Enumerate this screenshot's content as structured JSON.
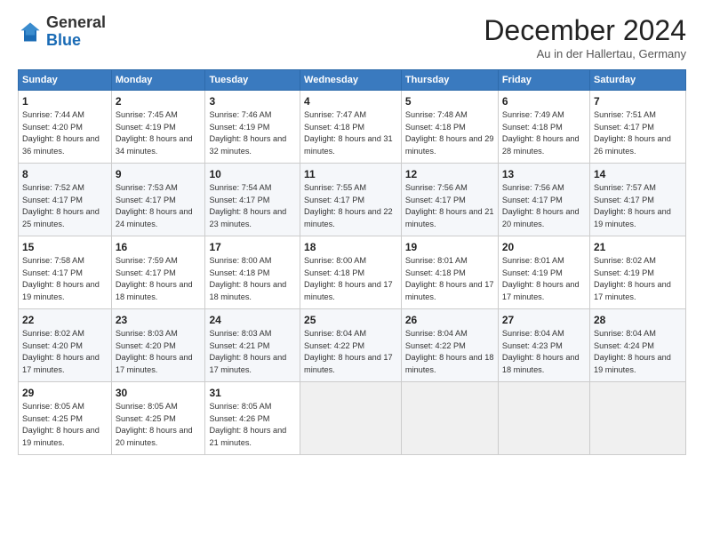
{
  "logo": {
    "general": "General",
    "blue": "Blue"
  },
  "header": {
    "title": "December 2024",
    "location": "Au in der Hallertau, Germany"
  },
  "columns": [
    "Sunday",
    "Monday",
    "Tuesday",
    "Wednesday",
    "Thursday",
    "Friday",
    "Saturday"
  ],
  "weeks": [
    [
      {
        "day": "1",
        "sunrise": "Sunrise: 7:44 AM",
        "sunset": "Sunset: 4:20 PM",
        "daylight": "Daylight: 8 hours and 36 minutes."
      },
      {
        "day": "2",
        "sunrise": "Sunrise: 7:45 AM",
        "sunset": "Sunset: 4:19 PM",
        "daylight": "Daylight: 8 hours and 34 minutes."
      },
      {
        "day": "3",
        "sunrise": "Sunrise: 7:46 AM",
        "sunset": "Sunset: 4:19 PM",
        "daylight": "Daylight: 8 hours and 32 minutes."
      },
      {
        "day": "4",
        "sunrise": "Sunrise: 7:47 AM",
        "sunset": "Sunset: 4:18 PM",
        "daylight": "Daylight: 8 hours and 31 minutes."
      },
      {
        "day": "5",
        "sunrise": "Sunrise: 7:48 AM",
        "sunset": "Sunset: 4:18 PM",
        "daylight": "Daylight: 8 hours and 29 minutes."
      },
      {
        "day": "6",
        "sunrise": "Sunrise: 7:49 AM",
        "sunset": "Sunset: 4:18 PM",
        "daylight": "Daylight: 8 hours and 28 minutes."
      },
      {
        "day": "7",
        "sunrise": "Sunrise: 7:51 AM",
        "sunset": "Sunset: 4:17 PM",
        "daylight": "Daylight: 8 hours and 26 minutes."
      }
    ],
    [
      {
        "day": "8",
        "sunrise": "Sunrise: 7:52 AM",
        "sunset": "Sunset: 4:17 PM",
        "daylight": "Daylight: 8 hours and 25 minutes."
      },
      {
        "day": "9",
        "sunrise": "Sunrise: 7:53 AM",
        "sunset": "Sunset: 4:17 PM",
        "daylight": "Daylight: 8 hours and 24 minutes."
      },
      {
        "day": "10",
        "sunrise": "Sunrise: 7:54 AM",
        "sunset": "Sunset: 4:17 PM",
        "daylight": "Daylight: 8 hours and 23 minutes."
      },
      {
        "day": "11",
        "sunrise": "Sunrise: 7:55 AM",
        "sunset": "Sunset: 4:17 PM",
        "daylight": "Daylight: 8 hours and 22 minutes."
      },
      {
        "day": "12",
        "sunrise": "Sunrise: 7:56 AM",
        "sunset": "Sunset: 4:17 PM",
        "daylight": "Daylight: 8 hours and 21 minutes."
      },
      {
        "day": "13",
        "sunrise": "Sunrise: 7:56 AM",
        "sunset": "Sunset: 4:17 PM",
        "daylight": "Daylight: 8 hours and 20 minutes."
      },
      {
        "day": "14",
        "sunrise": "Sunrise: 7:57 AM",
        "sunset": "Sunset: 4:17 PM",
        "daylight": "Daylight: 8 hours and 19 minutes."
      }
    ],
    [
      {
        "day": "15",
        "sunrise": "Sunrise: 7:58 AM",
        "sunset": "Sunset: 4:17 PM",
        "daylight": "Daylight: 8 hours and 19 minutes."
      },
      {
        "day": "16",
        "sunrise": "Sunrise: 7:59 AM",
        "sunset": "Sunset: 4:17 PM",
        "daylight": "Daylight: 8 hours and 18 minutes."
      },
      {
        "day": "17",
        "sunrise": "Sunrise: 8:00 AM",
        "sunset": "Sunset: 4:18 PM",
        "daylight": "Daylight: 8 hours and 18 minutes."
      },
      {
        "day": "18",
        "sunrise": "Sunrise: 8:00 AM",
        "sunset": "Sunset: 4:18 PM",
        "daylight": "Daylight: 8 hours and 17 minutes."
      },
      {
        "day": "19",
        "sunrise": "Sunrise: 8:01 AM",
        "sunset": "Sunset: 4:18 PM",
        "daylight": "Daylight: 8 hours and 17 minutes."
      },
      {
        "day": "20",
        "sunrise": "Sunrise: 8:01 AM",
        "sunset": "Sunset: 4:19 PM",
        "daylight": "Daylight: 8 hours and 17 minutes."
      },
      {
        "day": "21",
        "sunrise": "Sunrise: 8:02 AM",
        "sunset": "Sunset: 4:19 PM",
        "daylight": "Daylight: 8 hours and 17 minutes."
      }
    ],
    [
      {
        "day": "22",
        "sunrise": "Sunrise: 8:02 AM",
        "sunset": "Sunset: 4:20 PM",
        "daylight": "Daylight: 8 hours and 17 minutes."
      },
      {
        "day": "23",
        "sunrise": "Sunrise: 8:03 AM",
        "sunset": "Sunset: 4:20 PM",
        "daylight": "Daylight: 8 hours and 17 minutes."
      },
      {
        "day": "24",
        "sunrise": "Sunrise: 8:03 AM",
        "sunset": "Sunset: 4:21 PM",
        "daylight": "Daylight: 8 hours and 17 minutes."
      },
      {
        "day": "25",
        "sunrise": "Sunrise: 8:04 AM",
        "sunset": "Sunset: 4:22 PM",
        "daylight": "Daylight: 8 hours and 17 minutes."
      },
      {
        "day": "26",
        "sunrise": "Sunrise: 8:04 AM",
        "sunset": "Sunset: 4:22 PM",
        "daylight": "Daylight: 8 hours and 18 minutes."
      },
      {
        "day": "27",
        "sunrise": "Sunrise: 8:04 AM",
        "sunset": "Sunset: 4:23 PM",
        "daylight": "Daylight: 8 hours and 18 minutes."
      },
      {
        "day": "28",
        "sunrise": "Sunrise: 8:04 AM",
        "sunset": "Sunset: 4:24 PM",
        "daylight": "Daylight: 8 hours and 19 minutes."
      }
    ],
    [
      {
        "day": "29",
        "sunrise": "Sunrise: 8:05 AM",
        "sunset": "Sunset: 4:25 PM",
        "daylight": "Daylight: 8 hours and 19 minutes."
      },
      {
        "day": "30",
        "sunrise": "Sunrise: 8:05 AM",
        "sunset": "Sunset: 4:25 PM",
        "daylight": "Daylight: 8 hours and 20 minutes."
      },
      {
        "day": "31",
        "sunrise": "Sunrise: 8:05 AM",
        "sunset": "Sunset: 4:26 PM",
        "daylight": "Daylight: 8 hours and 21 minutes."
      },
      null,
      null,
      null,
      null
    ]
  ]
}
